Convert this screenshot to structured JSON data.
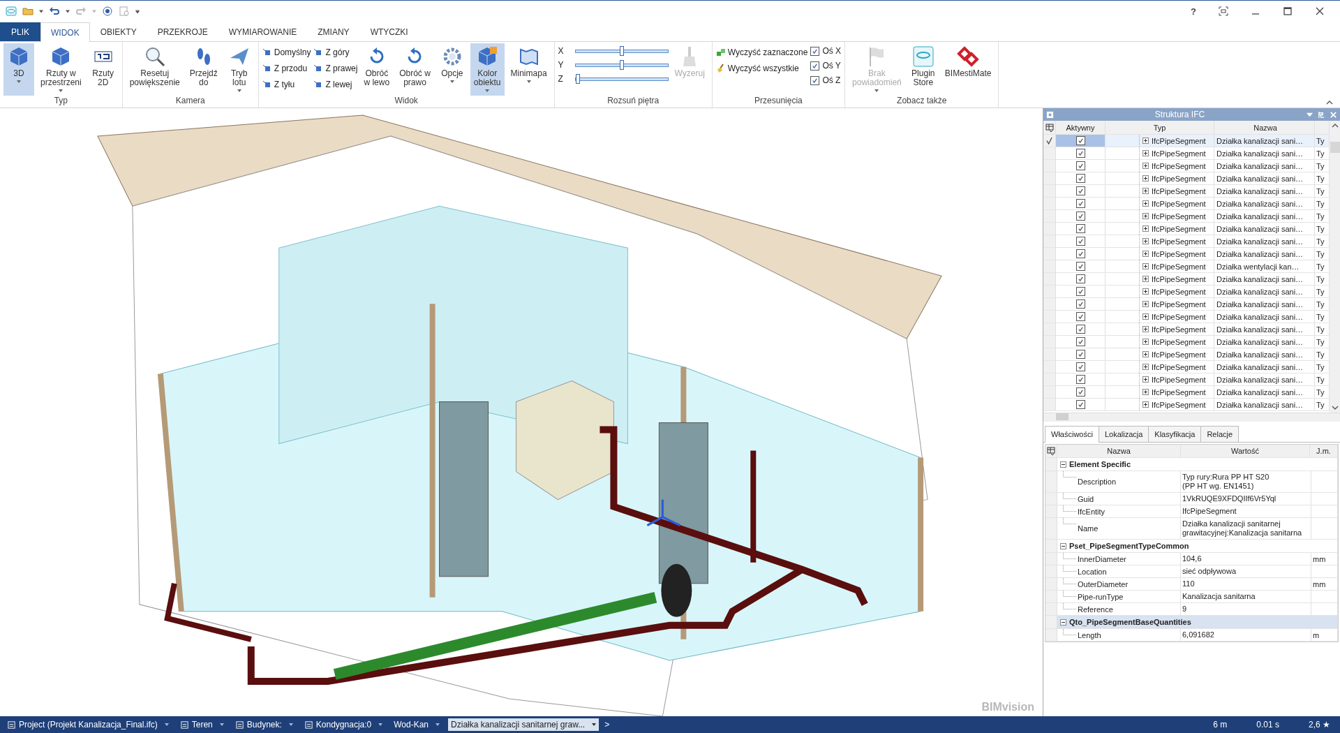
{
  "window": {
    "help": "?"
  },
  "ribbon": {
    "file_tab": "PLIK",
    "tabs": [
      {
        "label": "WIDOK",
        "selected": true
      },
      {
        "label": "OBIEKTY",
        "selected": false
      },
      {
        "label": "PRZEKROJE",
        "selected": false
      },
      {
        "label": "WYMIAROWANIE",
        "selected": false
      },
      {
        "label": "ZMIANY",
        "selected": false
      },
      {
        "label": "WTYCZKI",
        "selected": false
      }
    ],
    "groups": [
      {
        "label": "Typ",
        "items": [
          {
            "kind": "large",
            "lines": [
              "3D"
            ],
            "selected": true,
            "disabled": false,
            "dropdown": true
          },
          {
            "kind": "large",
            "lines": [
              "Rzuty w",
              "przestrzeni"
            ],
            "selected": false,
            "disabled": false,
            "dropdown": true
          },
          {
            "kind": "large",
            "lines": [
              "Rzuty",
              "2D"
            ],
            "selected": false,
            "disabled": false,
            "dropdown": false
          }
        ]
      },
      {
        "label": "Kamera",
        "items": [
          {
            "kind": "large",
            "lines": [
              "Resetuj",
              "powiększenie"
            ],
            "selected": false,
            "disabled": false,
            "dropdown": false
          },
          {
            "kind": "large",
            "lines": [
              "Przejdź",
              "do"
            ],
            "selected": false,
            "disabled": false,
            "dropdown": false
          },
          {
            "kind": "large",
            "lines": [
              "Tryb",
              "lotu"
            ],
            "selected": false,
            "disabled": false,
            "dropdown": true
          }
        ]
      },
      {
        "label": "Widok",
        "items": [
          {
            "kind": "small",
            "labels": [
              "Domyślny",
              "Z przodu",
              "Z tyłu"
            ]
          },
          {
            "kind": "small",
            "labels": [
              "Z góry",
              "Z prawej",
              "Z lewej"
            ]
          },
          {
            "kind": "large",
            "lines": [
              "Obróć",
              "w lewo"
            ],
            "selected": false,
            "disabled": false,
            "dropdown": false
          },
          {
            "kind": "large",
            "lines": [
              "Obróć w",
              "prawo"
            ],
            "selected": false,
            "disabled": false,
            "dropdown": false
          },
          {
            "kind": "large",
            "lines": [
              "Opcje"
            ],
            "selected": false,
            "disabled": false,
            "dropdown": true
          },
          {
            "kind": "large",
            "lines": [
              "Kolor",
              "obiektu"
            ],
            "selected": true,
            "disabled": false,
            "dropdown": true
          },
          {
            "kind": "large",
            "lines": [
              "Minimapa"
            ],
            "selected": false,
            "disabled": false,
            "dropdown": true
          }
        ]
      },
      {
        "label": "Rozsuń piętra",
        "items": [
          {
            "kind": "sliders",
            "sliders": [
              {
                "axis": "X",
                "level": 0.5
              },
              {
                "axis": "Y",
                "level": 0.5
              },
              {
                "axis": "Z",
                "level": 0
              }
            ]
          },
          {
            "kind": "large",
            "lines": [
              "Wyzeruj"
            ],
            "selected": false,
            "disabled": true,
            "dropdown": false
          }
        ]
      },
      {
        "label": "Przesunięcia",
        "items": [
          {
            "kind": "small",
            "labels": [
              "Wyczyść zaznaczone",
              "Wyczyść wszystkie"
            ]
          },
          {
            "kind": "checks",
            "checks": [
              {
                "label": "Oś X",
                "checked": true
              },
              {
                "label": "Oś Y",
                "checked": true
              },
              {
                "label": "Oś Z",
                "checked": true
              }
            ]
          }
        ]
      },
      {
        "label": "Zobacz także",
        "items": [
          {
            "kind": "large",
            "lines": [
              "Brak",
              "powiadomień"
            ],
            "selected": false,
            "disabled": true,
            "dropdown": true
          },
          {
            "kind": "large",
            "lines": [
              "Plugin",
              "Store"
            ],
            "selected": false,
            "disabled": false,
            "dropdown": false
          },
          {
            "kind": "large",
            "lines": [
              "BIMestiMate"
            ],
            "selected": false,
            "disabled": false,
            "dropdown": false
          }
        ]
      }
    ]
  },
  "viewport": {
    "logo": "BIMvision"
  },
  "ifc_structure": {
    "title": "Struktura IFC",
    "columns": [
      "Aktywny",
      "Typ",
      "Nazwa"
    ],
    "rows": [
      {
        "selected": true,
        "active": true,
        "type": "IfcPipeSegment",
        "name": "Działka kanalizacji sani…",
        "column_4": "Ty"
      },
      {
        "selected": false,
        "active": true,
        "type": "IfcPipeSegment",
        "name": "Działka kanalizacji sani…",
        "column_4": "Ty"
      },
      {
        "selected": false,
        "active": true,
        "type": "IfcPipeSegment",
        "name": "Działka kanalizacji sani…",
        "column_4": "Ty"
      },
      {
        "selected": false,
        "active": true,
        "type": "IfcPipeSegment",
        "name": "Działka kanalizacji sani…",
        "column_4": "Ty"
      },
      {
        "selected": false,
        "active": true,
        "type": "IfcPipeSegment",
        "name": "Działka kanalizacji sani…",
        "column_4": "Ty"
      },
      {
        "selected": false,
        "active": true,
        "type": "IfcPipeSegment",
        "name": "Działka kanalizacji sani…",
        "column_4": "Ty"
      },
      {
        "selected": false,
        "active": true,
        "type": "IfcPipeSegment",
        "name": "Działka kanalizacji sani…",
        "column_4": "Ty"
      },
      {
        "selected": false,
        "active": true,
        "type": "IfcPipeSegment",
        "name": "Działka kanalizacji sani…",
        "column_4": "Ty"
      },
      {
        "selected": false,
        "active": true,
        "type": "IfcPipeSegment",
        "name": "Działka kanalizacji sani…",
        "column_4": "Ty"
      },
      {
        "selected": false,
        "active": true,
        "type": "IfcPipeSegment",
        "name": "Działka kanalizacji sani…",
        "column_4": "Ty"
      },
      {
        "selected": false,
        "active": true,
        "type": "IfcPipeSegment",
        "name": "Działka wentylacji kan…",
        "column_4": "Ty"
      },
      {
        "selected": false,
        "active": true,
        "type": "IfcPipeSegment",
        "name": "Działka kanalizacji sani…",
        "column_4": "Ty"
      },
      {
        "selected": false,
        "active": true,
        "type": "IfcPipeSegment",
        "name": "Działka kanalizacji sani…",
        "column_4": "Ty"
      },
      {
        "selected": false,
        "active": true,
        "type": "IfcPipeSegment",
        "name": "Działka kanalizacji sani…",
        "column_4": "Ty"
      },
      {
        "selected": false,
        "active": true,
        "type": "IfcPipeSegment",
        "name": "Działka kanalizacji sani…",
        "column_4": "Ty"
      },
      {
        "selected": false,
        "active": true,
        "type": "IfcPipeSegment",
        "name": "Działka kanalizacji sani…",
        "column_4": "Ty"
      },
      {
        "selected": false,
        "active": true,
        "type": "IfcPipeSegment",
        "name": "Działka kanalizacji sani…",
        "column_4": "Ty"
      },
      {
        "selected": false,
        "active": true,
        "type": "IfcPipeSegment",
        "name": "Działka kanalizacji sani…",
        "column_4": "Ty"
      },
      {
        "selected": false,
        "active": true,
        "type": "IfcPipeSegment",
        "name": "Działka kanalizacji sani…",
        "column_4": "Ty"
      },
      {
        "selected": false,
        "active": true,
        "type": "IfcPipeSegment",
        "name": "Działka kanalizacji sani…",
        "column_4": "Ty"
      },
      {
        "selected": false,
        "active": true,
        "type": "IfcPipeSegment",
        "name": "Działka kanalizacji sani…",
        "column_4": "Ty"
      },
      {
        "selected": false,
        "active": true,
        "type": "IfcPipeSegment",
        "name": "Działka kanalizacji sani…",
        "column_4": "Ty"
      }
    ]
  },
  "properties": {
    "tabs": [
      {
        "label": "Właściwości",
        "selected": true
      },
      {
        "label": "Lokalizacja",
        "selected": false
      },
      {
        "label": "Klasyfikacja",
        "selected": false
      },
      {
        "label": "Relacje",
        "selected": false
      }
    ],
    "columns": [
      "Nazwa",
      "Wartość",
      "J.m."
    ],
    "sections": [
      {
        "title": "Element Specific",
        "expanded": true,
        "selected": false,
        "rows": [
          {
            "name": "Description",
            "value": [
              "Typ rury:Rura PP HT S20",
              "(PP HT wg. EN1451)"
            ],
            "unit": ""
          },
          {
            "name": "Guid",
            "value": [
              "1VkRUQE9XFDQIIf6Vr5Yql"
            ],
            "unit": ""
          },
          {
            "name": "IfcEntity",
            "value": [
              "IfcPipeSegment"
            ],
            "unit": ""
          },
          {
            "name": "Name",
            "value": [
              "Działka kanalizacji sanitarnej",
              "grawitacyjnej:Kanalizacja sanitarna"
            ],
            "unit": ""
          }
        ]
      },
      {
        "title": "Pset_PipeSegmentTypeCommon",
        "expanded": true,
        "selected": false,
        "rows": [
          {
            "name": "InnerDiameter",
            "value": [
              "104,6"
            ],
            "unit": "mm"
          },
          {
            "name": "Location",
            "value": [
              "sieć odpływowa"
            ],
            "unit": ""
          },
          {
            "name": "OuterDiameter",
            "value": [
              "110"
            ],
            "unit": "mm"
          },
          {
            "name": "Pipe-runType",
            "value": [
              "Kanalizacja sanitarna"
            ],
            "unit": ""
          },
          {
            "name": "Reference",
            "value": [
              "9"
            ],
            "unit": ""
          }
        ]
      },
      {
        "title": "Qto_PipeSegmentBaseQuantities",
        "expanded": true,
        "selected": true,
        "rows": [
          {
            "name": "Length",
            "value": [
              "6,091682"
            ],
            "unit": "m"
          }
        ]
      }
    ]
  },
  "status_bar": {
    "breadcrumbs": [
      {
        "label": "Project (Projekt Kanalizacja_Final.ifc)",
        "kind": "project",
        "selected": false
      },
      {
        "label": "Teren",
        "kind": "site",
        "selected": false
      },
      {
        "label": "Budynek:",
        "kind": "building",
        "selected": false
      },
      {
        "label": "Kondygnacja:0",
        "kind": "storey",
        "selected": false
      },
      {
        "label": "Wod-Kan",
        "kind": "plain",
        "selected": false
      },
      {
        "label": "Działka kanalizacji sanitarnej graw...",
        "kind": "plain",
        "selected": true
      }
    ],
    "more": ">",
    "stats": [
      "6 m",
      "0.01 s",
      "2,6 ★"
    ]
  }
}
